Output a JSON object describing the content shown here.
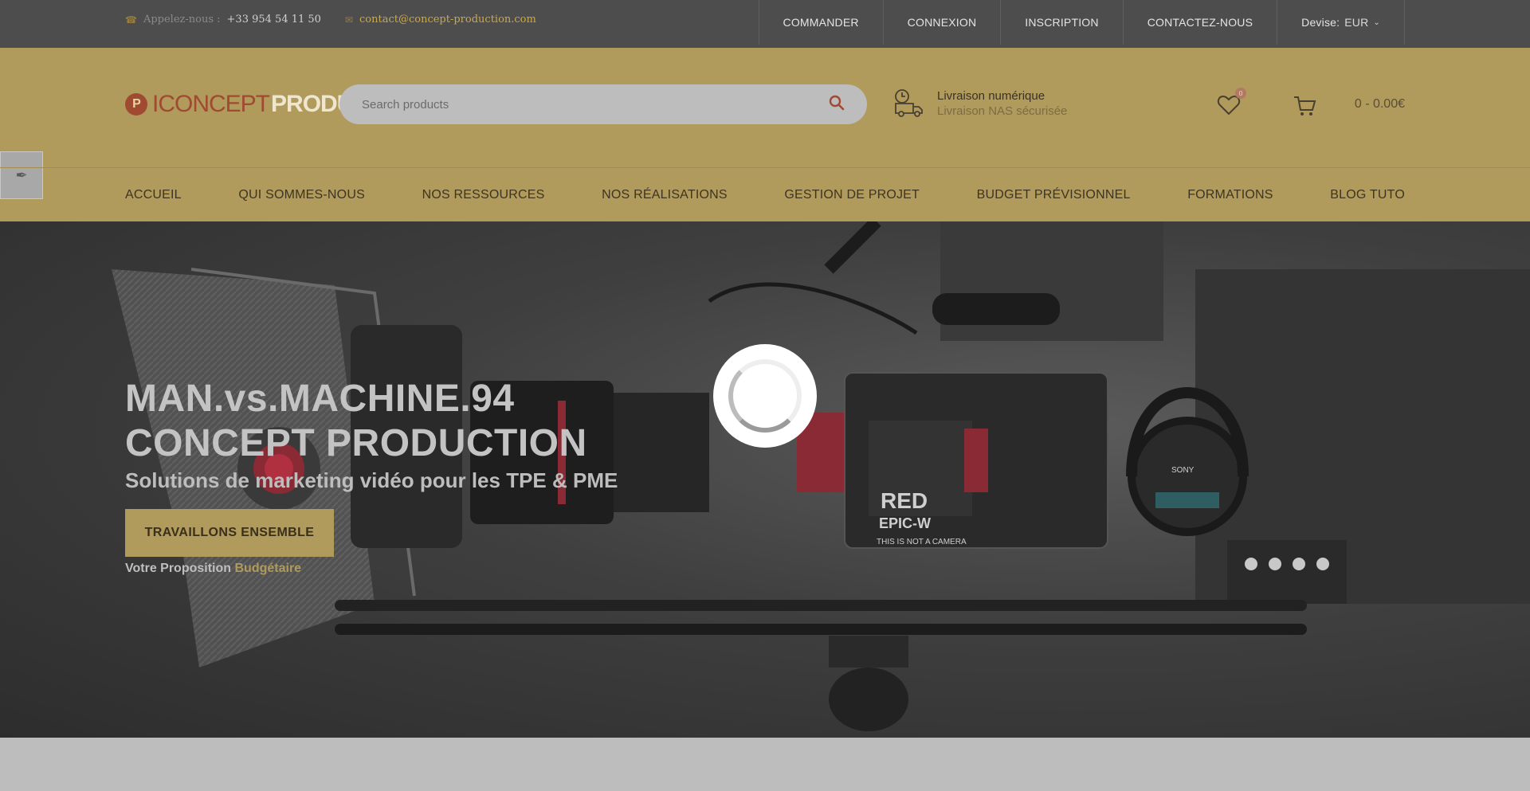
{
  "topbar": {
    "phone_label": "Appelez-nous :",
    "phone": "+33 954 54 11 50",
    "email": "contact@concept-production.com",
    "links": [
      "COMMANDER",
      "CONNEXION",
      "INSCRIPTION",
      "CONTACTEZ-NOUS"
    ],
    "currency_label": "Devise:",
    "currency_value": "EUR"
  },
  "header": {
    "logo_initial": "P",
    "logo_part1": "ICONCEPT",
    "logo_part2": "PRODUCTION",
    "search_placeholder": "Search products",
    "delivery_title": "Livraison numérique",
    "delivery_subtitle": "Livraison NAS sécurisée",
    "wishlist_count": "0",
    "cart_total": "0 - 0.00€"
  },
  "nav": {
    "items": [
      "ACCUEIL",
      "QUI SOMMES-NOUS",
      "NOS RESSOURCES",
      "NOS RÉALISATIONS",
      "GESTION DE PROJET",
      "BUDGET PRÉVISIONNEL",
      "FORMATIONS",
      "BLOG TUTO"
    ]
  },
  "hero": {
    "title_line1": "MAN.vs.MACHINE.94",
    "title_line2": "CONCEPT PRODUCTION",
    "subtitle": "Solutions de marketing vidéo pour les TPE & PME",
    "cta": "TRAVAILLONS ENSEMBLE",
    "proposition_text": "Votre Proposition",
    "proposition_accent": "Budgétaire",
    "camera_brand": "RED",
    "camera_model": "EPIC-W",
    "camera_tagline": "THIS IS NOT A CAMERA",
    "headphone_brand": "SONY"
  },
  "colors": {
    "accent": "#b09a5c",
    "topbar_bg": "#4d4d4d",
    "logo_red": "#a04a32"
  }
}
